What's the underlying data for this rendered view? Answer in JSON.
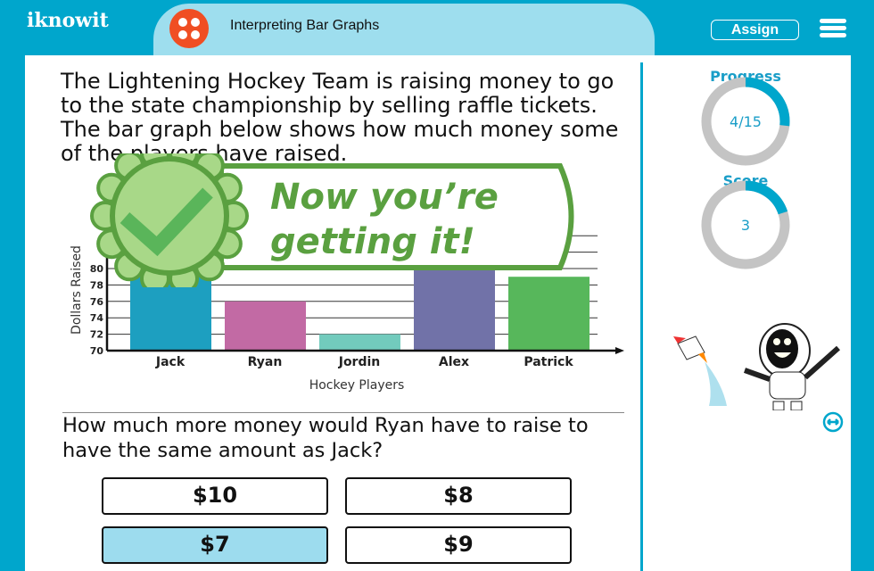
{
  "header": {
    "logo": "iknowit",
    "lesson_title": "Interpreting Bar Graphs",
    "assign_label": "Assign",
    "menu_icon": "hamburger-icon",
    "lesson_icon": "four-dots-icon"
  },
  "question": {
    "text": "The Lightening Hockey Team is raising money to go to the state championship by selling raffle tickets. The bar graph below shows how much money some of the players have raised.",
    "prompt": "How much more money would Ryan have to raise to have the same amount as Jack?"
  },
  "answers": [
    {
      "label": "$10",
      "selected": false
    },
    {
      "label": "$8",
      "selected": false
    },
    {
      "label": "$7",
      "selected": true
    },
    {
      "label": "$9",
      "selected": false
    }
  ],
  "feedback": {
    "text_line1": "Now you’re",
    "text_line2": "getting it!",
    "icon": "check-seal-icon"
  },
  "progress": {
    "label": "Progress",
    "value": "4/15",
    "fraction": 0.267
  },
  "score": {
    "label": "Score",
    "value": "3",
    "fraction": 0.2
  },
  "colors": {
    "brand": "#00a6cc",
    "selected": "#9ddcee",
    "feedback_green": "#5aa040"
  },
  "chart_data": {
    "type": "bar",
    "xlabel": "Hockey Players",
    "ylabel": "Dollars Raised",
    "ylim": [
      70,
      84
    ],
    "yticks": [
      70,
      72,
      74,
      76,
      78,
      80
    ],
    "grid": true,
    "categories": [
      "Jack",
      "Ryan",
      "Jordin",
      "Alex",
      "Patrick"
    ],
    "values": [
      83,
      76,
      72,
      82,
      79
    ],
    "colors": [
      "#1d9fc0",
      "#c26aa4",
      "#72cbbd",
      "#7172a8",
      "#57b75b"
    ]
  }
}
